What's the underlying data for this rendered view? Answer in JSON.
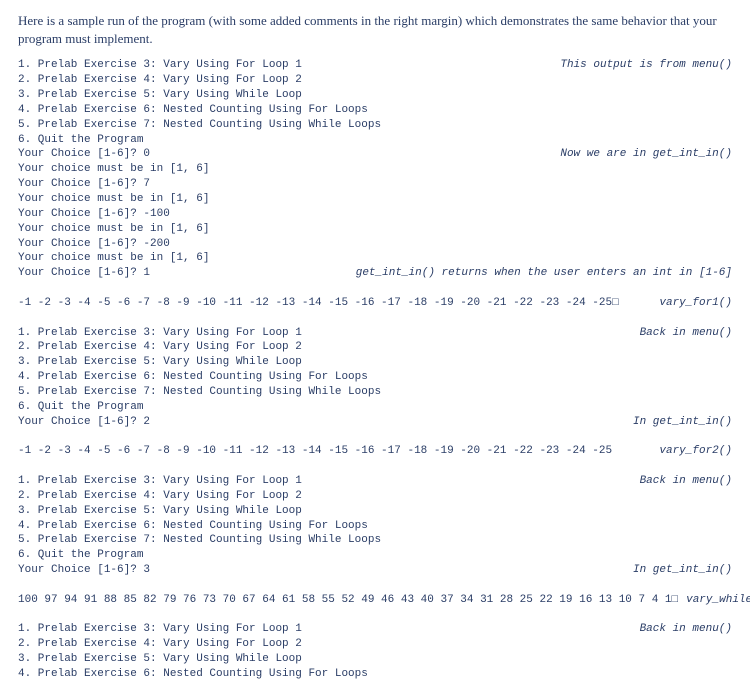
{
  "intro": "Here is a sample run of the program (with some added comments in the right margin) which demonstrates the same behavior that your program must implement.",
  "lines": [
    {
      "left": "1. Prelab Exercise 3: Vary Using For Loop 1",
      "right": "This output is from menu()"
    },
    {
      "left": "2. Prelab Exercise 4: Vary Using For Loop 2",
      "right": ""
    },
    {
      "left": "3. Prelab Exercise 5: Vary Using While Loop",
      "right": ""
    },
    {
      "left": "4. Prelab Exercise 6: Nested Counting Using For Loops",
      "right": ""
    },
    {
      "left": "5. Prelab Exercise 7: Nested Counting Using While Loops",
      "right": ""
    },
    {
      "left": "6. Quit the Program",
      "right": ""
    },
    {
      "left": "Your Choice [1-6]? 0",
      "right": "Now we are in get_int_in()"
    },
    {
      "left": "Your choice must be in [1, 6]",
      "right": ""
    },
    {
      "left": "Your Choice [1-6]? 7",
      "right": ""
    },
    {
      "left": "Your choice must be in [1, 6]",
      "right": ""
    },
    {
      "left": "Your Choice [1-6]? -100",
      "right": ""
    },
    {
      "left": "Your choice must be in [1, 6]",
      "right": ""
    },
    {
      "left": "Your Choice [1-6]? -200",
      "right": ""
    },
    {
      "left": "Your choice must be in [1, 6]",
      "right": ""
    },
    {
      "left": "Your Choice [1-6]? 1",
      "right": "get_int_in() returns when the user enters an int in [1-6]"
    },
    {
      "left": "",
      "right": ""
    },
    {
      "left": "-1 -2 -3 -4 -5 -6 -7 -8 -9 -10 -11 -12 -13 -14 -15 -16 -17 -18 -19 -20 -21 -22 -23 -24 -25□",
      "right": "vary_for1()"
    },
    {
      "left": "",
      "right": ""
    },
    {
      "left": "1. Prelab Exercise 3: Vary Using For Loop 1",
      "right": "Back in menu()"
    },
    {
      "left": "2. Prelab Exercise 4: Vary Using For Loop 2",
      "right": ""
    },
    {
      "left": "3. Prelab Exercise 5: Vary Using While Loop",
      "right": ""
    },
    {
      "left": "4. Prelab Exercise 6: Nested Counting Using For Loops",
      "right": ""
    },
    {
      "left": "5. Prelab Exercise 7: Nested Counting Using While Loops",
      "right": ""
    },
    {
      "left": "6. Quit the Program",
      "right": ""
    },
    {
      "left": "Your Choice [1-6]? 2",
      "right": "In get_int_in()"
    },
    {
      "left": "",
      "right": ""
    },
    {
      "left": "-1 -2 -3 -4 -5 -6 -7 -8 -9 -10 -11 -12 -13 -14 -15 -16 -17 -18 -19 -20 -21 -22 -23 -24 -25",
      "right": "vary_for2()"
    },
    {
      "left": "",
      "right": ""
    },
    {
      "left": "1. Prelab Exercise 3: Vary Using For Loop 1",
      "right": "Back in menu()"
    },
    {
      "left": "2. Prelab Exercise 4: Vary Using For Loop 2",
      "right": ""
    },
    {
      "left": "3. Prelab Exercise 5: Vary Using While Loop",
      "right": ""
    },
    {
      "left": "4. Prelab Exercise 6: Nested Counting Using For Loops",
      "right": ""
    },
    {
      "left": "5. Prelab Exercise 7: Nested Counting Using While Loops",
      "right": ""
    },
    {
      "left": "6. Quit the Program",
      "right": ""
    },
    {
      "left": "Your Choice [1-6]? 3",
      "right": "In get_int_in()"
    },
    {
      "left": "",
      "right": ""
    },
    {
      "left": "100 97 94 91 88 85 82 79 76 73 70 67 64 61 58 55 52 49 46 43 40 37 34 31 28 25 22 19 16 13 10 7 4 1□",
      "right": "vary_while()"
    },
    {
      "left": "",
      "right": ""
    },
    {
      "left": "1. Prelab Exercise 3: Vary Using For Loop 1",
      "right": "Back in menu()"
    },
    {
      "left": "2. Prelab Exercise 4: Vary Using For Loop 2",
      "right": ""
    },
    {
      "left": "3. Prelab Exercise 5: Vary Using While Loop",
      "right": ""
    },
    {
      "left": "4. Prelab Exercise 6: Nested Counting Using For Loops",
      "right": ""
    }
  ]
}
